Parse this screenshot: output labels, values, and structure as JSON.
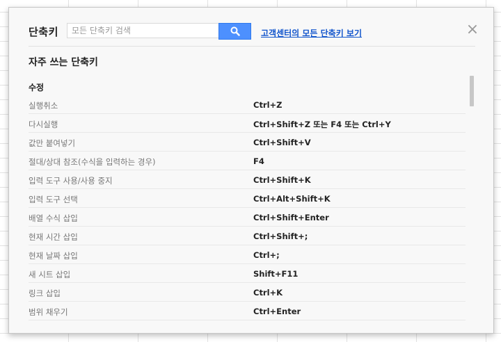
{
  "dialog": {
    "title": "단축키",
    "search": {
      "placeholder": "모든 단축키 검색",
      "value": ""
    },
    "help_link": "고객센터의 모든 단축키 보기",
    "close_symbol": "×",
    "section_title": "자주 쓰는 단축키",
    "category_title": "수정",
    "shortcuts": [
      {
        "name": "실행취소",
        "keys": "Ctrl+Z"
      },
      {
        "name": "다시실행",
        "keys": "Ctrl+Shift+Z 또는 F4 또는 Ctrl+Y"
      },
      {
        "name": "값만 붙여넣기",
        "keys": "Ctrl+Shift+V"
      },
      {
        "name": "절대/상대 참조(수식을 입력하는 경우)",
        "keys": "F4"
      },
      {
        "name": "입력 도구 사용/사용 중지",
        "keys": "Ctrl+Shift+K"
      },
      {
        "name": "입력 도구 선택",
        "keys": "Ctrl+Alt+Shift+K"
      },
      {
        "name": "배열 수식 삽입",
        "keys": "Ctrl+Shift+Enter"
      },
      {
        "name": "현재 시간 삽입",
        "keys": "Ctrl+Shift+;"
      },
      {
        "name": "현재 날짜 삽입",
        "keys": "Ctrl+;"
      },
      {
        "name": "새 시트 삽입",
        "keys": "Shift+F11"
      },
      {
        "name": "링크 삽입",
        "keys": "Ctrl+K"
      },
      {
        "name": "범위 채우기",
        "keys": "Ctrl+Enter"
      }
    ]
  },
  "colors": {
    "search_button": "#4d90fe",
    "link": "#1155cc"
  }
}
